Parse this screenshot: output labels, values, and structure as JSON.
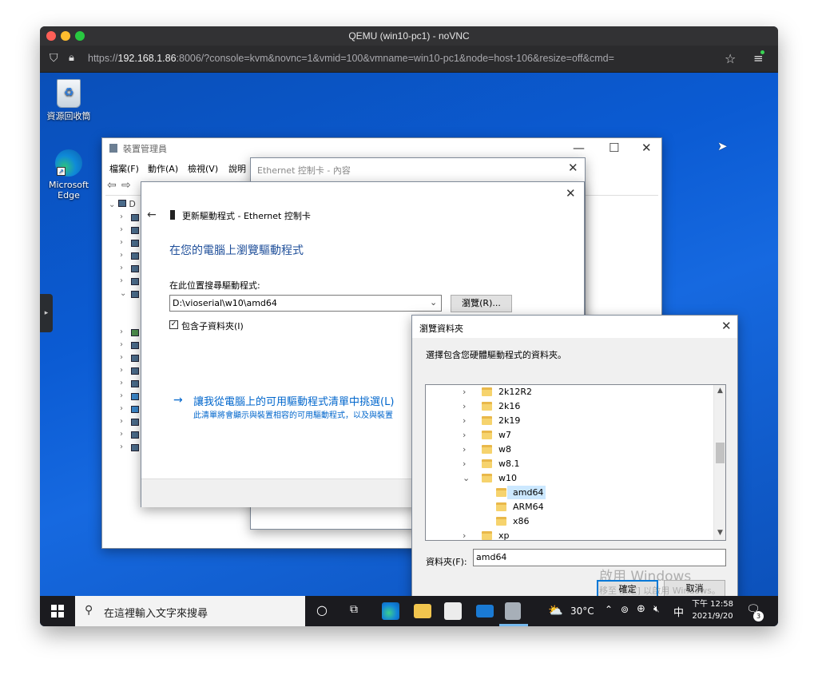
{
  "browser": {
    "title": "QEMU (win10-pc1) - noVNC",
    "url_prefix": "https://",
    "url_host": "192.168.1.86",
    "url_rest": ":8006/?console=kvm&novnc=1&vmid=100&vmname=win10-pc1&node=host-106&resize=off&cmd="
  },
  "desktop": {
    "icons": [
      {
        "label": "資源回收筒",
        "icon": "recycle-bin-icon"
      },
      {
        "label": "Microsoft Edge",
        "icon": "edge-icon"
      }
    ]
  },
  "devmgr": {
    "title": "裝置管理員",
    "menu": [
      "檔案(F)",
      "動作(A)",
      "檢視(V)",
      "說明"
    ],
    "root_label": "D"
  },
  "props": {
    "title": "Ethernet 控制卡 - 內容"
  },
  "update": {
    "header": "更新驅動程式 - Ethernet 控制卡",
    "heading": "在您的電腦上瀏覽驅動程式",
    "search_label": "在此位置搜尋驅動程式:",
    "path_value": "D:\\vioserial\\w10\\amd64",
    "browse_button": "瀏覽(R)...",
    "include_subfolders": "包含子資料夾(I)",
    "pick_link": "讓我從電腦上的可用驅動程式清單中挑選(L)",
    "pick_desc": "此清單將會顯示與裝置相容的可用驅動程式，以及與裝置"
  },
  "browse": {
    "title": "瀏覽資料夾",
    "prompt": "選擇包含您硬體驅動程式的資料夾。",
    "folders": [
      {
        "name": "2k12R2",
        "level": 1,
        "expander": "right"
      },
      {
        "name": "2k16",
        "level": 1,
        "expander": "right"
      },
      {
        "name": "2k19",
        "level": 1,
        "expander": "right"
      },
      {
        "name": "w7",
        "level": 1,
        "expander": "right"
      },
      {
        "name": "w8",
        "level": 1,
        "expander": "right"
      },
      {
        "name": "w8.1",
        "level": 1,
        "expander": "right"
      },
      {
        "name": "w10",
        "level": 1,
        "expander": "down"
      },
      {
        "name": "amd64",
        "level": 2,
        "expander": "none",
        "selected": true
      },
      {
        "name": "ARM64",
        "level": 2,
        "expander": "none"
      },
      {
        "name": "x86",
        "level": 2,
        "expander": "none"
      },
      {
        "name": "xp",
        "level": 1,
        "expander": "right"
      }
    ],
    "folder_label": "資料夾(F):",
    "folder_value": "amd64",
    "ok": "確定",
    "cancel": "取消",
    "watermark1": "啟用 Windows",
    "watermark2": "移至 設定] 以啟用 Windows。"
  },
  "taskbar": {
    "search_placeholder": "在這裡輸入文字來搜尋",
    "weather": "30°C",
    "ime": "中",
    "time": "下午 12:58",
    "date": "2021/9/20",
    "notifications": "3"
  },
  "colors": {
    "accent": "#0b5bd3",
    "link": "#0066cc",
    "selection": "#cce8ff"
  }
}
